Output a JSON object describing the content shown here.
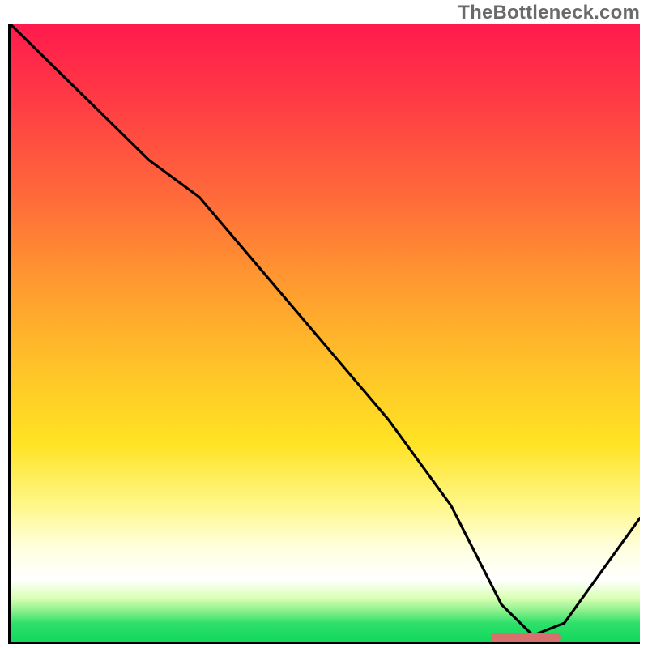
{
  "watermark": "TheBottleneck.com",
  "chart_data": {
    "type": "line",
    "title": "",
    "xlabel": "",
    "ylabel": "",
    "xlim": [
      0,
      100
    ],
    "ylim": [
      0,
      100
    ],
    "grid": false,
    "legend": false,
    "background": {
      "style": "vertical-gradient",
      "stops": [
        {
          "pos": 0,
          "color": "#ff1a4d"
        },
        {
          "pos": 28,
          "color": "#ff6a3a"
        },
        {
          "pos": 56,
          "color": "#ffc428"
        },
        {
          "pos": 78,
          "color": "#fff78a"
        },
        {
          "pos": 90,
          "color": "#ffffff"
        },
        {
          "pos": 100,
          "color": "#12d85e"
        }
      ]
    },
    "series": [
      {
        "name": "bottleneck-curve",
        "x": [
          0,
          10,
          22,
          30,
          40,
          50,
          60,
          70,
          78,
          83,
          88,
          100
        ],
        "y": [
          100,
          90,
          78,
          72,
          60,
          48,
          36,
          22,
          6,
          1,
          3,
          20
        ]
      }
    ],
    "annotations": [
      {
        "name": "optimal-zone-marker",
        "type": "bar",
        "x_start": 76,
        "x_end": 87,
        "y": 1,
        "color": "#d8706b"
      }
    ]
  }
}
